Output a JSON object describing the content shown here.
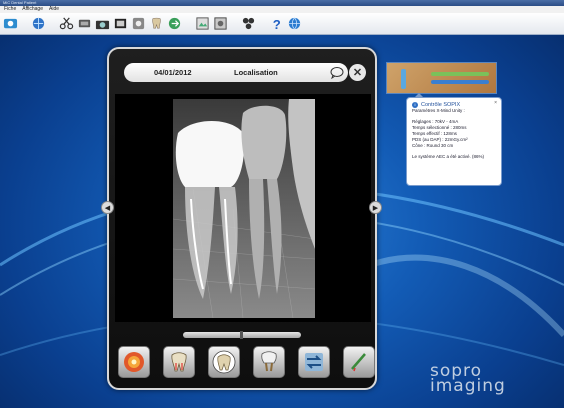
{
  "window": {
    "title": "MiC Dental Patient"
  },
  "menu": {
    "items": [
      "Fiche",
      "Affichage",
      "Aide"
    ]
  },
  "toolbar": {
    "icons": [
      "patient-icon",
      "globe-icon",
      "scissors-icon",
      "tools-icon",
      "camera-icon",
      "film-icon",
      "media-icon",
      "dental-chart-icon",
      "export-icon",
      "image-icon",
      "photo-icon",
      "camera-sensor-icon",
      "help-icon",
      "network-icon"
    ]
  },
  "viewer": {
    "date": "04/01/2012",
    "title": "Localisation",
    "tools": [
      "color-map-tool",
      "tooth-root-tool",
      "tooth-crown-tool",
      "tooth-implant-tool",
      "swap-tool",
      "measure-tool"
    ]
  },
  "popup": {
    "title": "Contrôle SOPIX",
    "lines": [
      "Paramètres X-Mind Unity :",
      "",
      "Réglages : 70kV - 4mA",
      "Temps sélectionné : 280ms",
      "Temps effectif : 128ms",
      "PDS (au DAP) : 22mGy.cm²",
      "Cône : Round 30 cm",
      "",
      "Le système AEC a été activé. (86%)"
    ]
  },
  "logo": {
    "line1": "sopro",
    "line2": "imaging"
  },
  "colors": {
    "accent": "#1f4e9a",
    "desktop": "#135cb6"
  }
}
